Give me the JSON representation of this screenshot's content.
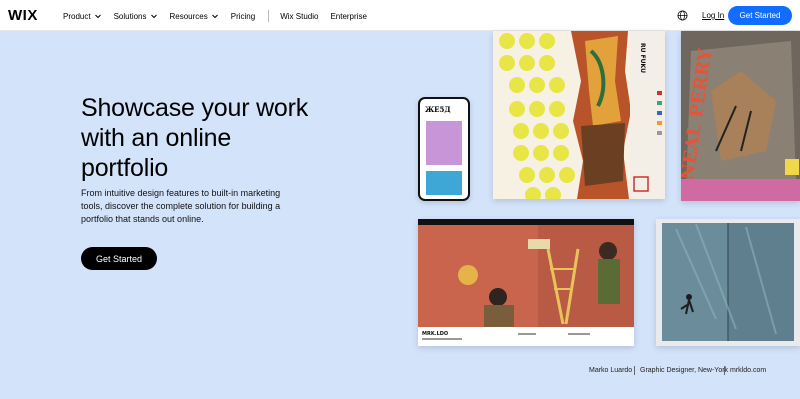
{
  "header": {
    "logo": "WIX",
    "nav": [
      {
        "label": "Product",
        "dropdown": true
      },
      {
        "label": "Solutions",
        "dropdown": true
      },
      {
        "label": "Resources",
        "dropdown": true
      },
      {
        "label": "Pricing",
        "dropdown": false
      }
    ],
    "nav_secondary": [
      "Wix Studio",
      "Enterprise"
    ],
    "login": "Log In",
    "cta": "Get Started"
  },
  "hero": {
    "title": "Showcase your work with an online portfolio",
    "subtitle": "From intuitive design features to built-in marketing tools, discover the complete solution for building a portfolio that stands out online.",
    "cta": "Get Started"
  },
  "cards": {
    "phone_title": "ЖЕ5Д",
    "poster_a_title": "RU FUKU",
    "poster_b_title": "NEAL PERRY",
    "screen_c_name": "MRK.LDO"
  },
  "credit": {
    "name": "Marko Luardo",
    "role": "Graphic Designer, New-York",
    "site": "mrkldo.com"
  },
  "colors": {
    "background": "#d3e3fa",
    "accent": "#116dff",
    "cta_main": "#000000"
  }
}
